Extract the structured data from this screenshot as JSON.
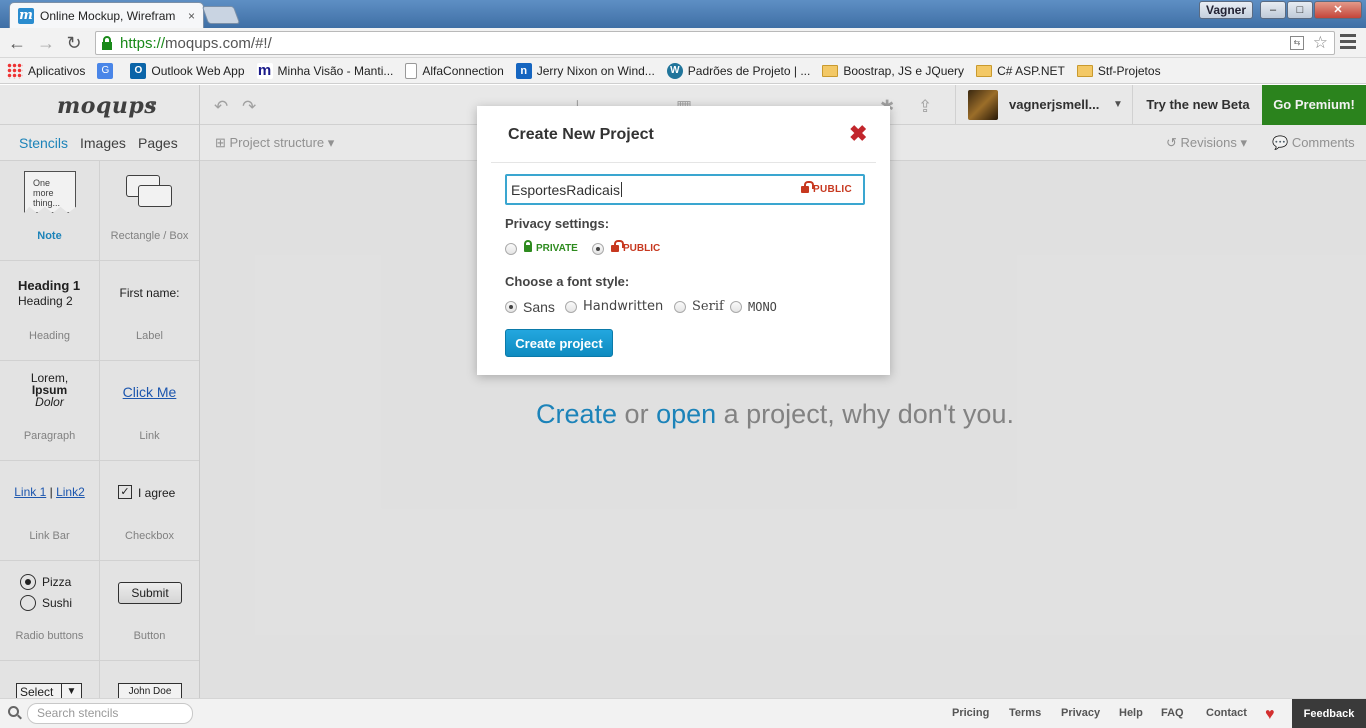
{
  "browser": {
    "tab_title": "Online Mockup, Wirefram",
    "tab_close": "×",
    "favicon_letter": "m",
    "user_chip": "Vagner",
    "url_scheme": "https://",
    "url_rest": "moqups.com/#!/",
    "win_min": "–",
    "win_max": "□",
    "win_close": "✕"
  },
  "bookmarks": [
    {
      "icon": "apps-grid-icon",
      "label": "Aplicativos"
    },
    {
      "icon": "translate-icon",
      "label": ""
    },
    {
      "icon": "outlook-icon",
      "label": "Outlook Web App"
    },
    {
      "icon": "mantis-icon",
      "label": "Minha Visão - Manti..."
    },
    {
      "icon": "page-icon",
      "label": "AlfaConnection"
    },
    {
      "icon": "msdn-icon",
      "label": "Jerry Nixon on Wind..."
    },
    {
      "icon": "wordpress-icon",
      "label": "Padrões de Projeto | ..."
    },
    {
      "icon": "folder-icon",
      "label": "Boostrap, JS e JQuery"
    },
    {
      "icon": "folder-icon",
      "label": "C# ASP.NET"
    },
    {
      "icon": "folder-icon",
      "label": "Stf-Projetos"
    }
  ],
  "app": {
    "logo": "moqups",
    "user_name": "vagnerjsmell...",
    "try_beta": "Try the new Beta",
    "premium": "Go Premium!",
    "tabs": [
      "Stencils",
      "Images",
      "Pages"
    ],
    "project_structure": "Project structure",
    "revisions": "Revisions",
    "comments": "Comments",
    "search_placeholder": "Search stencils",
    "footer_links": [
      "Pricing",
      "Terms",
      "Privacy",
      "Help",
      "FAQ",
      "Contact"
    ],
    "feedback": "Feedback",
    "canvas_msg": {
      "create": "Create",
      "or": " or ",
      "open": "open",
      "rest": " a project, why don't you."
    }
  },
  "stencils": {
    "note": {
      "text": "One more thing...",
      "caption": "Note"
    },
    "rectangle": {
      "caption": "Rectangle / Box"
    },
    "heading": {
      "h1": "Heading 1",
      "h2": "Heading 2",
      "caption": "Heading"
    },
    "label": {
      "text": "First name:",
      "caption": "Label"
    },
    "paragraph": {
      "line1": "Lorem,",
      "line2": "Ipsum",
      "line3": "Dolor",
      "caption": "Paragraph"
    },
    "link": {
      "text": "Click Me",
      "caption": "Link"
    },
    "linkbar": {
      "link1": "Link 1",
      "sep": "|",
      "link2": "Link2",
      "caption": "Link Bar"
    },
    "checkbox": {
      "check": "✓",
      "text": "I agree",
      "caption": "Checkbox"
    },
    "radio": {
      "opt1": "Pizza",
      "opt2": "Sushi",
      "caption": "Radio buttons"
    },
    "button": {
      "text": "Submit",
      "caption": "Button"
    },
    "select": {
      "text": "Select",
      "arrow": "▼"
    },
    "textfield": {
      "text": "John Doe"
    }
  },
  "modal": {
    "title": "Create New Project",
    "close": "✖",
    "project_name": "EsportesRadicais",
    "name_badge": "PUBLIC",
    "privacy_label": "Privacy settings:",
    "privacy_options": [
      "PRIVATE",
      "PUBLIC"
    ],
    "privacy_selected": "PUBLIC",
    "font_label": "Choose a font style:",
    "font_options": [
      "Sans",
      "Handwritten",
      "Serif",
      "MONO"
    ],
    "font_selected": "Sans",
    "create_button": "Create project"
  },
  "colors": {
    "accent": "#1e8bc3",
    "premium": "#2e8b1f",
    "public": "#c7381f",
    "private": "#2e8b1f",
    "close": "#c2262c"
  }
}
